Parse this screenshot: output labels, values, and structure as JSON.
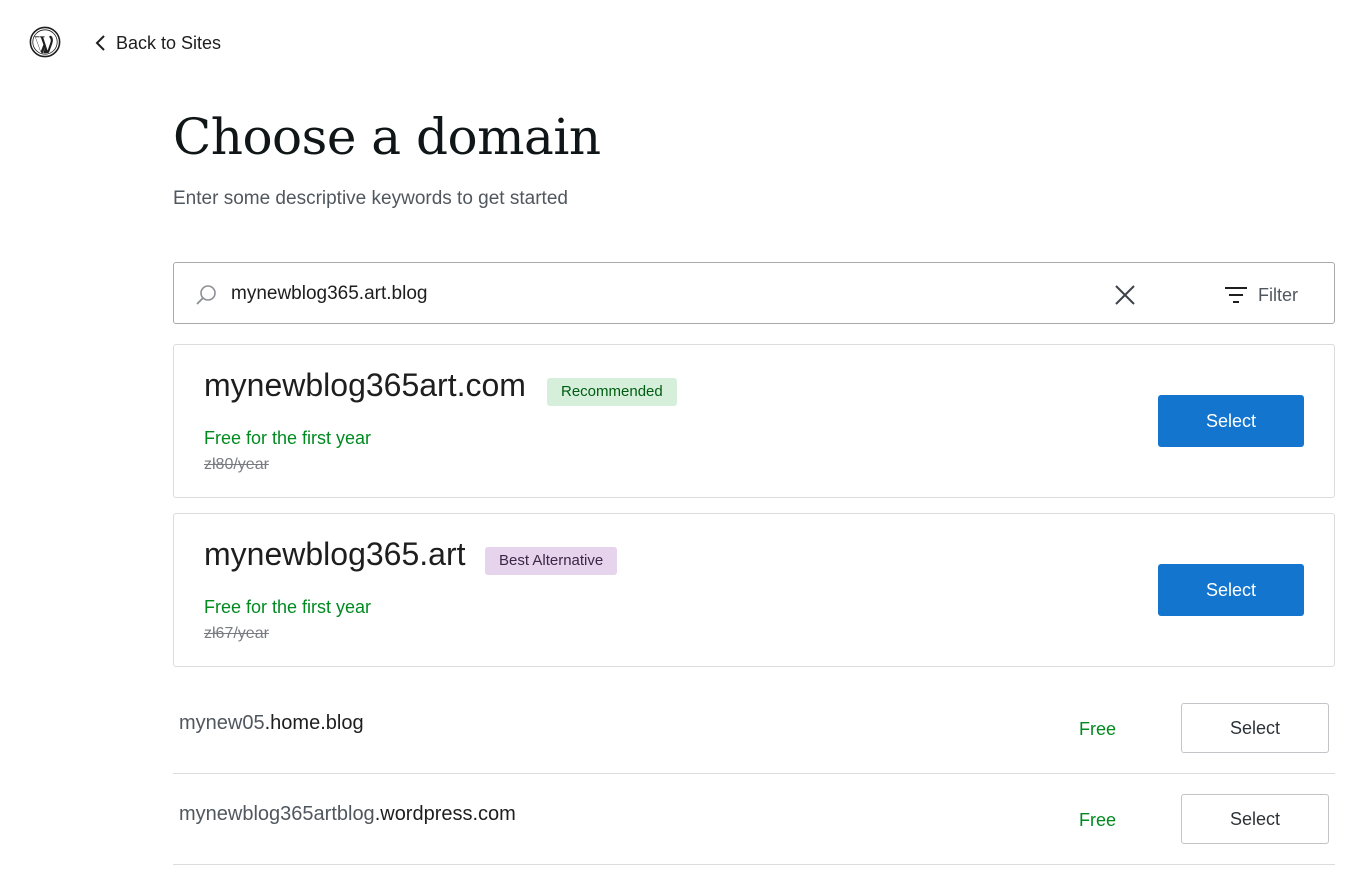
{
  "header": {
    "logo_icon": "wordpress-logo-icon",
    "back_label": "Back to Sites"
  },
  "page": {
    "title": "Choose a domain",
    "subtitle": "Enter some descriptive keywords to get started"
  },
  "search": {
    "value": "mynewblog365.art.blog",
    "placeholder": "",
    "filter_label": "Filter"
  },
  "featured": [
    {
      "domain": "mynewblog365art.com",
      "badge": "Recommended",
      "promo": "Free for the first year",
      "original_price": "zł80/year",
      "select_label": "Select"
    },
    {
      "domain": "mynewblog365.art",
      "badge": "Best Alternative",
      "promo": "Free for the first year",
      "original_price": "zł67/year",
      "select_label": "Select"
    }
  ],
  "results": [
    {
      "name": "mynew05",
      "tld": ".home.blog",
      "price": "Free",
      "select_label": "Select"
    },
    {
      "name": "mynewblog365artblog",
      "tld": ".wordpress.com",
      "price": "Free",
      "select_label": "Select"
    }
  ],
  "colors": {
    "primary": "#1475cf",
    "free_text": "#008a20",
    "recommended_badge_bg": "#d6efdb",
    "alternative_badge_bg": "#e6d3ec"
  }
}
